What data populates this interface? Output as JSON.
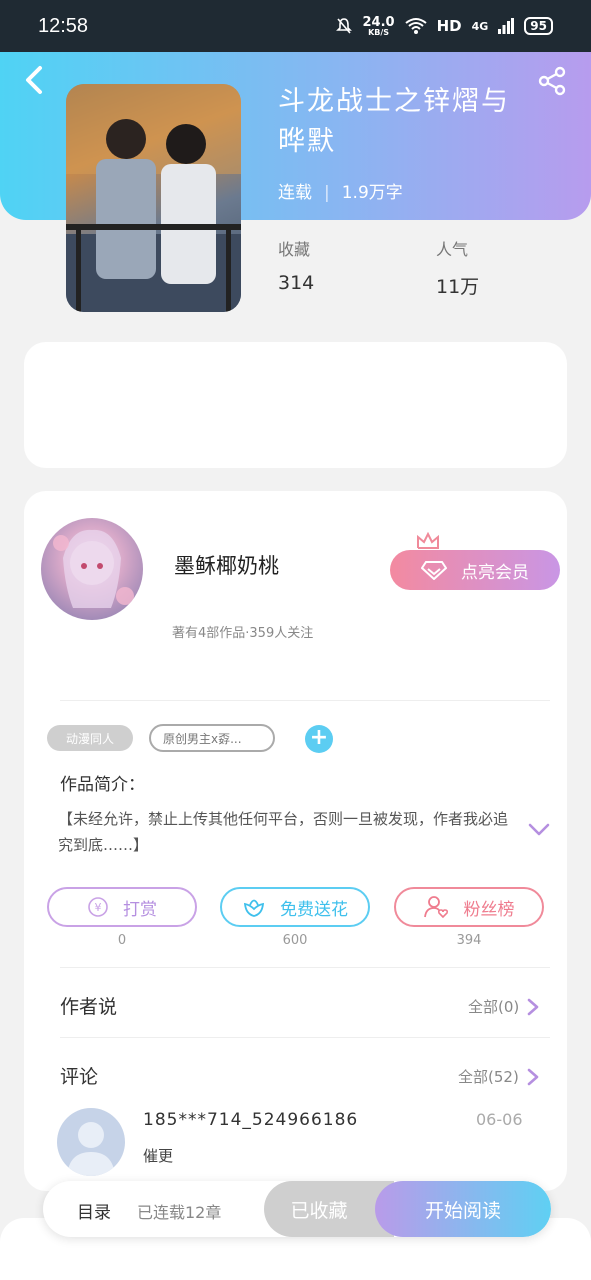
{
  "status_bar": {
    "time": "12:58",
    "net_speed_value": "24.0",
    "net_speed_unit": "KB/S",
    "hd": "HD",
    "signal": "4G",
    "battery": "95"
  },
  "book": {
    "title": "斗龙战士之锌熠与晔默",
    "status": "连载",
    "word_count": "1.9万字",
    "favorites_label": "收藏",
    "favorites_value": "314",
    "popularity_label": "人气",
    "popularity_value": "11万"
  },
  "author": {
    "name": "墨稣椰奶桃",
    "summary": "著有4部作品·359人关注",
    "vip_button": "点亮会员"
  },
  "tags": {
    "tag1": "动漫同人",
    "tag2": "原创男主x孬...",
    "add": "+"
  },
  "intro": {
    "title": "作品简介：",
    "text": "【未经允许，禁止上传其他任何平台，否则一旦被发现，作者我必追究到底……】"
  },
  "actions": {
    "reward_label": "打赏",
    "reward_count": "0",
    "flower_label": "免费送花",
    "flower_count": "600",
    "fans_label": "粉丝榜",
    "fans_count": "394"
  },
  "author_says": {
    "title": "作者说",
    "link": "全部(0)"
  },
  "comments": {
    "title": "评论",
    "link": "全部(52)",
    "items": [
      {
        "user": "185***714_524966186",
        "text": "催更",
        "date": "06-06"
      }
    ]
  },
  "bottom_bar": {
    "catalog": "目录",
    "chapters": "已连载12章",
    "collected": "已收藏",
    "start_reading": "开始阅读"
  },
  "colors": {
    "header_gradient_start": "#4fd3f4",
    "header_gradient_end": "#b79cee",
    "accent_blue": "#5ccdf2",
    "accent_pink": "#f08a9a",
    "accent_purple": "#c9a2e6"
  }
}
